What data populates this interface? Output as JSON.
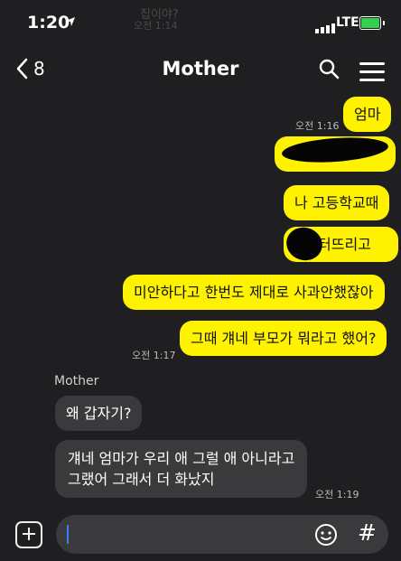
{
  "status_bar": {
    "time": "1:20",
    "network": "LTE"
  },
  "background_ghost": {
    "text": "집이야?",
    "time": "오전 1:14"
  },
  "header": {
    "back_count": "8",
    "title": "Mother"
  },
  "messages": [
    {
      "side": "me",
      "text": "엄마"
    },
    {
      "side": "me",
      "text": ""
    },
    {
      "side": "me",
      "text": "나 고등학교때"
    },
    {
      "side": "me",
      "text": "터뜨리고"
    },
    {
      "side": "me",
      "text": "미안하다고 한번도 제대로 사과안했잖아"
    },
    {
      "side": "me",
      "text": "그때 걔네 부모가 뭐라고 했어?"
    },
    {
      "side": "them",
      "text": "왜 갑자기?"
    },
    {
      "side": "them",
      "text": "걔네 엄마가 우리 애 그럴 애 아니라고\n그랬어 그래서 더 화났지"
    }
  ],
  "timestamps": {
    "t1": "오전 1:16",
    "t2": "오전 1:17",
    "t3": "오전 1:19"
  },
  "sender_name": "Mother",
  "input": {
    "value": "",
    "hash_label": "#"
  }
}
